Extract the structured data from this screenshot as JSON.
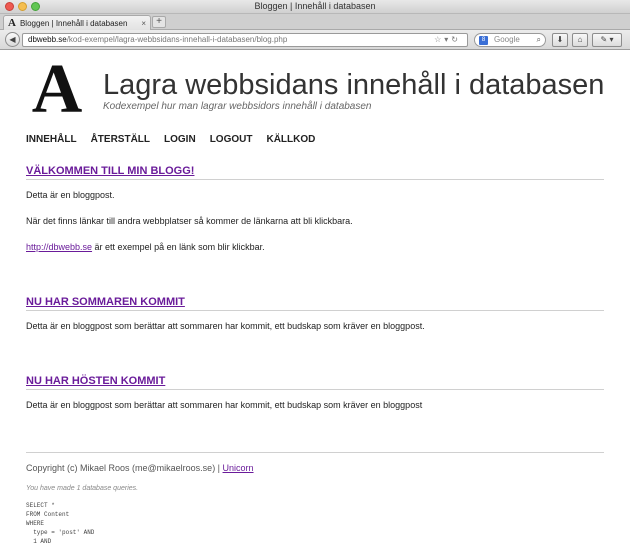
{
  "window": {
    "title": "Bloggen | Innehåll i databasen"
  },
  "tab": {
    "favicon": "A",
    "label": "Bloggen | Innehåll i databasen",
    "close": "×",
    "new_tab": "+"
  },
  "nav": {
    "url_host": "dbwebb.se",
    "url_path": "/kod-exempel/lagra-webbsidans-innehall-i-databasen/blog.php",
    "search_placeholder": "Google",
    "search_engine_icon": "google-icon"
  },
  "site": {
    "logo": "A",
    "title": "Lagra webbsidans innehåll i databasen",
    "slogan": "Kodexempel hur man lagrar webbsidors innehåll i databasen"
  },
  "menu": [
    {
      "label": "INNEHÅLL"
    },
    {
      "label": "ÅTERSTÄLL"
    },
    {
      "label": "LOGIN"
    },
    {
      "label": "LOGOUT"
    },
    {
      "label": "KÄLLKOD"
    }
  ],
  "posts": [
    {
      "title": "VÄLKOMMEN TILL MIN BLOGG!",
      "p1": "Detta är en bloggpost.",
      "p2": "När det finns länkar till andra webbplatser så kommer de länkarna att bli klickbara.",
      "link": "http://dbwebb.se",
      "p3_rest": " är ett exempel på en länk som blir klickbar."
    },
    {
      "title": "NU HAR SOMMAREN KOMMIT",
      "p1": "Detta är en bloggpost som berättar att sommaren har kommit, ett budskap som kräver en bloggpost."
    },
    {
      "title": "NU HAR HÖSTEN KOMMIT",
      "p1": "Detta är en bloggpost som berättar att sommaren har kommit, ett budskap som kräver en bloggpost"
    }
  ],
  "footer": {
    "copyright": "Copyright (c) Mikael Roos (me@mikaelroos.se) | ",
    "link": "Unicorn",
    "queries": "You have made 1 database queries.",
    "sql": "SELECT *\nFROM Content\nWHERE\n  type = 'post' AND\n  1 AND"
  }
}
